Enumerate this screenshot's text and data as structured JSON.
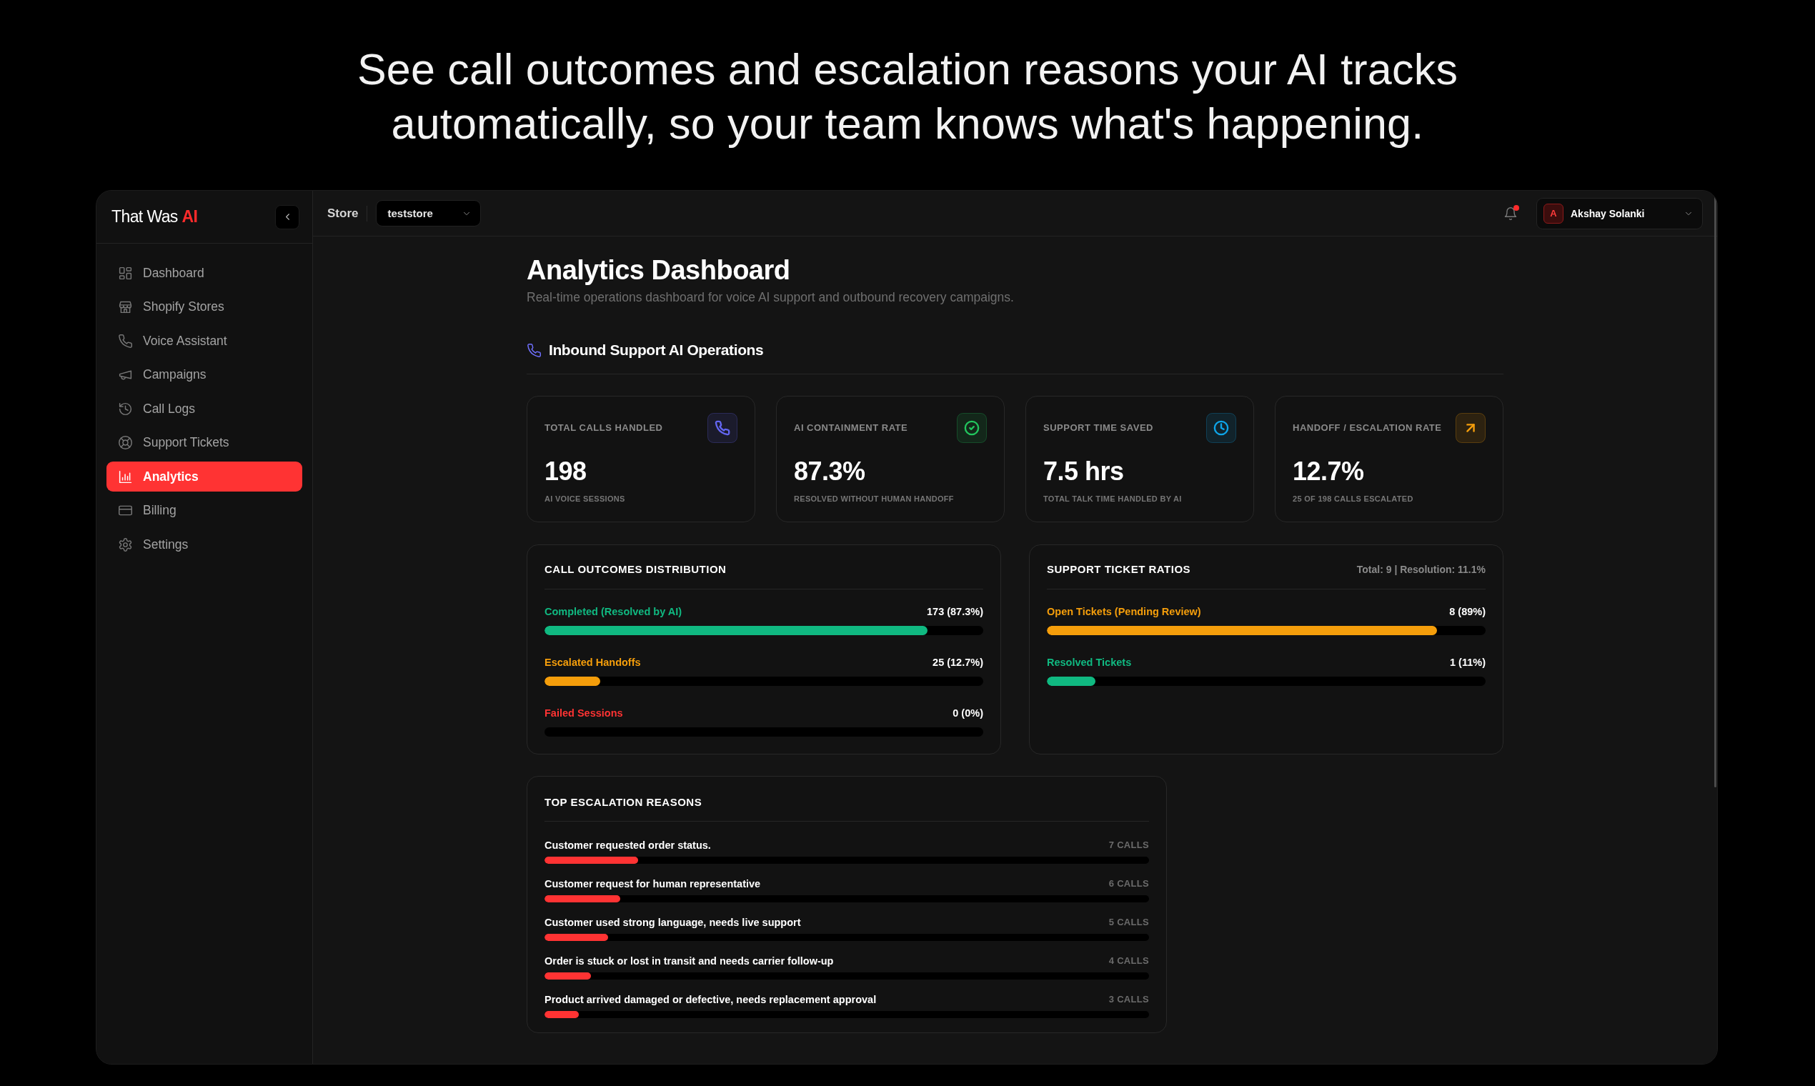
{
  "headline": "See call outcomes and escalation reasons your AI tracks automatically, so your team knows what's happening.",
  "sidebar": {
    "logo": "That Was **AI**",
    "items": [
      {
        "label": "Dashboard",
        "selected": false
      },
      {
        "label": "Shopify Stores",
        "selected": false
      },
      {
        "label": "Voice Assistant",
        "selected": false
      },
      {
        "label": "Campaigns",
        "selected": false
      },
      {
        "label": "Call Logs",
        "selected": false
      },
      {
        "label": "Support Tickets",
        "selected": false
      },
      {
        "label": "Analytics",
        "selected": true
      },
      {
        "label": "Billing",
        "selected": false
      },
      {
        "label": "Settings",
        "selected": false
      }
    ]
  },
  "topbar": {
    "store_label": "Store",
    "store_select": {
      "value": "teststore"
    },
    "notifications": {
      "unread": true
    },
    "user": {
      "initial": "A",
      "name": "Akshay Solanki"
    }
  },
  "page": {
    "title": "Analytics Dashboard",
    "subtitle": "Real-time operations dashboard for voice AI support and outbound recovery campaigns.",
    "section_title": "Inbound Support AI Operations"
  },
  "kpis": [
    {
      "label": "TOTAL CALLS HANDLED",
      "value": "198",
      "caption": "AI VOICE SESSIONS",
      "color": "#6366f1"
    },
    {
      "label": "AI CONTAINMENT RATE",
      "value": "87.3%",
      "caption": "RESOLVED WITHOUT HUMAN HANDOFF",
      "color": "#22c55e"
    },
    {
      "label": "SUPPORT TIME SAVED",
      "value": "7.5 hrs",
      "caption": "TOTAL TALK TIME HANDLED BY AI",
      "color": "#0ea5e9"
    },
    {
      "label": "HANDOFF / ESCALATION RATE",
      "value": "12.7%",
      "caption": "25 OF 198 CALLS ESCALATED",
      "color": "#f59e0b"
    }
  ],
  "call_outcomes": {
    "title": "CALL OUTCOMES DISTRIBUTION",
    "rows": [
      {
        "label": "Completed (Resolved by AI)",
        "reading": "173 (87.3%)",
        "level": 0.873,
        "color": "#10b981"
      },
      {
        "label": "Escalated Handoffs",
        "reading": "25 (12.7%)",
        "level": 0.127,
        "color": "#f59e0b"
      },
      {
        "label": "Failed Sessions",
        "reading": "0 (0%)",
        "level": 0,
        "color": "#ff3333"
      }
    ]
  },
  "ticket_ratios": {
    "title": "SUPPORT TICKET RATIOS",
    "summary": "Total: 9 | Resolution: 11.1%",
    "rows": [
      {
        "label": "Open Tickets (Pending Review)",
        "reading": "8 (89%)",
        "level": 0.89,
        "color": "#f59e0b"
      },
      {
        "label": "Resolved Tickets",
        "reading": "1 (11%)",
        "level": 0.11,
        "color": "#10b981"
      }
    ]
  },
  "escalation_reasons": {
    "title": "TOP ESCALATION REASONS",
    "rows": [
      {
        "label": "Customer requested order status.",
        "count": "7 CALLS",
        "level": 0.155
      },
      {
        "label": "Customer request for human representative",
        "count": "6 CALLS",
        "level": 0.125
      },
      {
        "label": "Customer used strong language, needs live support",
        "count": "5 CALLS",
        "level": 0.105
      },
      {
        "label": "Order is stuck or lost in transit and needs carrier follow-up",
        "count": "4 CALLS",
        "level": 0.077
      },
      {
        "label": "Product arrived damaged or defective, needs replacement approval",
        "count": "3 CALLS",
        "level": 0.057
      }
    ]
  }
}
